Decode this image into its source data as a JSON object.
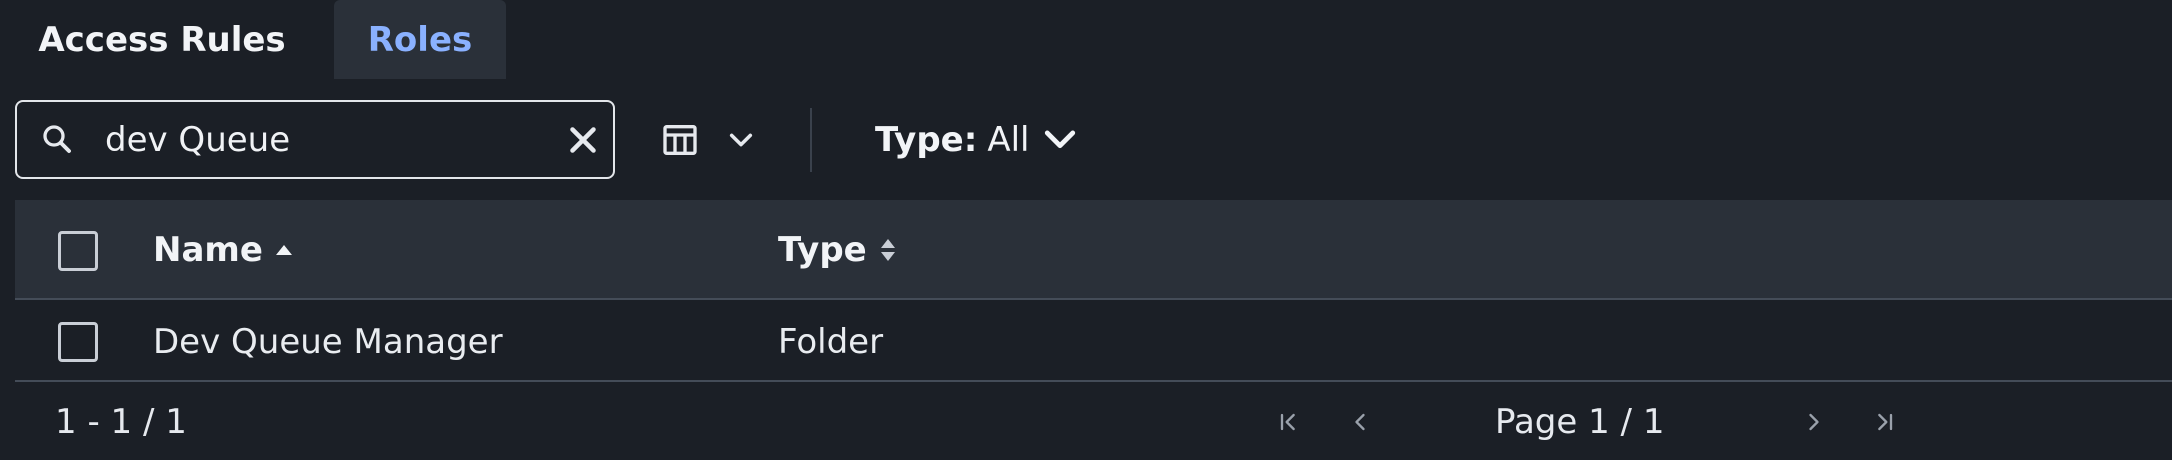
{
  "tabs": [
    {
      "label": "Access Rules",
      "active": false
    },
    {
      "label": "Roles",
      "active": true
    }
  ],
  "toolbar": {
    "search_value": "dev Queue",
    "type_filter_label": "Type:",
    "type_filter_value": "All"
  },
  "table": {
    "columns": [
      {
        "label": "Name",
        "sort": "ascending"
      },
      {
        "label": "Type",
        "sort": "none"
      }
    ],
    "rows": [
      {
        "name": "Dev Queue Manager",
        "type": "Folder",
        "selected": false
      }
    ]
  },
  "footer": {
    "range": "1 - 1 / 1",
    "page_info": "Page 1 / 1"
  },
  "icons": {
    "search": "search-icon",
    "clear": "close-icon",
    "columns": "table-columns-icon",
    "chevron": "chevron-down-icon",
    "first_page": "first-page-icon",
    "prev_page": "chevron-left-icon",
    "next_page": "chevron-right-icon",
    "last_page": "last-page-icon"
  },
  "colors": {
    "background": "#1b1f26",
    "header_background": "#2a3039",
    "accent": "#8ab1ff",
    "text": "#e6e9ee"
  }
}
